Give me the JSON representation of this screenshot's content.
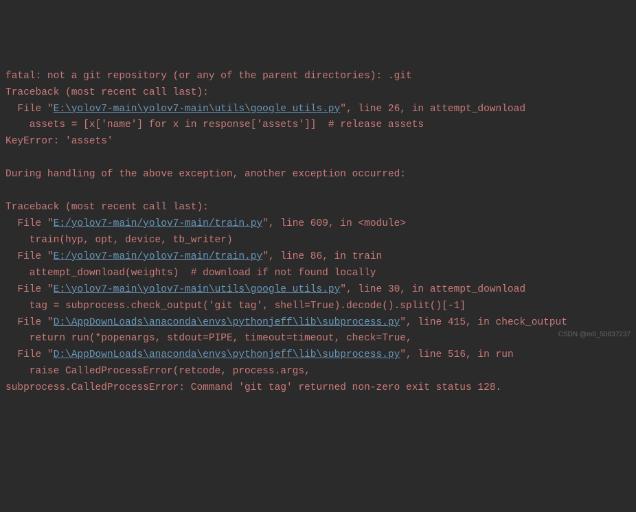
{
  "lines": [
    {
      "segments": [
        {
          "text": "fatal: not a git repository (or any of the parent directories): .git"
        }
      ]
    },
    {
      "segments": [
        {
          "text": "Traceback (most recent call last):"
        }
      ]
    },
    {
      "segments": [
        {
          "text": "  File \""
        },
        {
          "text": "E:\\yolov7-main\\yolov7-main\\utils\\google_utils.py",
          "link": true
        },
        {
          "text": "\", line 26, in attempt_download"
        }
      ]
    },
    {
      "segments": [
        {
          "text": "    assets = [x['name'] for x in response['assets']]  # release assets"
        }
      ]
    },
    {
      "segments": [
        {
          "text": "KeyError: 'assets'"
        }
      ]
    },
    {
      "segments": [
        {
          "text": " "
        }
      ]
    },
    {
      "segments": [
        {
          "text": "During handling of the above exception, another exception occurred:"
        }
      ]
    },
    {
      "segments": [
        {
          "text": " "
        }
      ]
    },
    {
      "segments": [
        {
          "text": "Traceback (most recent call last):"
        }
      ]
    },
    {
      "segments": [
        {
          "text": "  File \""
        },
        {
          "text": "E:/yolov7-main/yolov7-main/train.py",
          "link": true
        },
        {
          "text": "\", line 609, in <module>"
        }
      ]
    },
    {
      "segments": [
        {
          "text": "    train(hyp, opt, device, tb_writer)"
        }
      ]
    },
    {
      "segments": [
        {
          "text": "  File \""
        },
        {
          "text": "E:/yolov7-main/yolov7-main/train.py",
          "link": true
        },
        {
          "text": "\", line 86, in train"
        }
      ]
    },
    {
      "segments": [
        {
          "text": "    attempt_download(weights)  # download if not found locally"
        }
      ]
    },
    {
      "segments": [
        {
          "text": "  File \""
        },
        {
          "text": "E:\\yolov7-main\\yolov7-main\\utils\\google_utils.py",
          "link": true
        },
        {
          "text": "\", line 30, in attempt_download"
        }
      ]
    },
    {
      "segments": [
        {
          "text": "    tag = subprocess.check_output('git tag', shell=True).decode().split()[-1]"
        }
      ]
    },
    {
      "segments": [
        {
          "text": "  File \""
        },
        {
          "text": "D:\\AppDownLoads\\anaconda\\envs\\pythonjeff\\lib\\subprocess.py",
          "link": true
        },
        {
          "text": "\", line 415, in check_output"
        }
      ]
    },
    {
      "segments": [
        {
          "text": "    return run(*popenargs, stdout=PIPE, timeout=timeout, check=True,"
        }
      ]
    },
    {
      "segments": [
        {
          "text": "  File \""
        },
        {
          "text": "D:\\AppDownLoads\\anaconda\\envs\\pythonjeff\\lib\\subprocess.py",
          "link": true
        },
        {
          "text": "\", line 516, in run"
        }
      ]
    },
    {
      "segments": [
        {
          "text": "    raise CalledProcessError(retcode, process.args,"
        }
      ]
    },
    {
      "segments": [
        {
          "text": "subprocess.CalledProcessError: Command 'git tag' returned non-zero exit status 128."
        }
      ]
    }
  ],
  "watermark": "CSDN @m0_50837237"
}
